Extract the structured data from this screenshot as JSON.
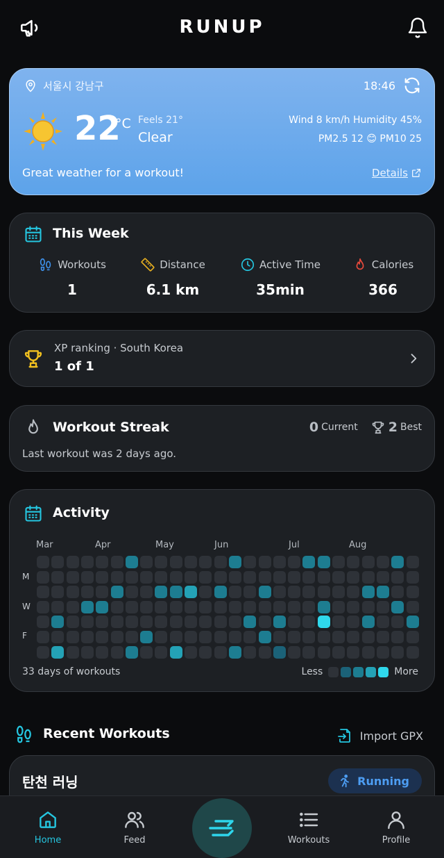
{
  "header": {
    "logo": "RUNUP",
    "left_icon": "megaphone-icon",
    "right_icon": "bell-icon"
  },
  "weather": {
    "location": "서울시 강남구",
    "time": "18:46",
    "temperature": "22",
    "unit": "°C",
    "feels_like": "Feels 21°",
    "condition": "Clear",
    "wind_humidity": "Wind 8 km/h  Humidity 45%",
    "pm_prefix": "PM2.5 12",
    "pm_emoji": "😊",
    "pm_suffix": "PM10 25",
    "message": "Great weather for a workout!",
    "details_label": "Details"
  },
  "this_week": {
    "title": "This Week",
    "stats": [
      {
        "label": "Workouts",
        "value": "1",
        "icon": "footprints-icon",
        "color": "#3d8fe8"
      },
      {
        "label": "Distance",
        "value": "6.1 km",
        "icon": "ruler-icon",
        "color": "#e8b020"
      },
      {
        "label": "Active Time",
        "value": "35min",
        "icon": "clock-icon",
        "color": "#25c6e0"
      },
      {
        "label": "Calories",
        "value": "366",
        "icon": "flame-icon",
        "color": "#ea4a3c"
      }
    ]
  },
  "ranking": {
    "subtitle": "XP ranking · South Korea",
    "value": "1 of 1"
  },
  "streak": {
    "title": "Workout Streak",
    "current_value": "0",
    "current_label": "Current",
    "best_value": "2",
    "best_label": "Best",
    "subtitle": "Last workout was 2 days ago."
  },
  "activity": {
    "title": "Activity",
    "months": [
      "Mar",
      "Apr",
      "May",
      "Jun",
      "Jul",
      "Aug"
    ],
    "day_labels": [
      "M",
      "W",
      "F"
    ],
    "footer": "33 days of workouts",
    "legend_less": "Less",
    "legend_more": "More",
    "levels_colors": [
      "#2e3238",
      "#1b6278",
      "#1d7d91",
      "#24a2b6",
      "#2fd8ec"
    ],
    "legend_colors": [
      "#2e3238",
      "#1b6278",
      "#1d7d91",
      "#24a2b6",
      "#2fd8ec"
    ],
    "weeks": 26,
    "active_cells": [
      [
        6,
        0,
        2
      ],
      [
        13,
        0,
        2
      ],
      [
        18,
        0,
        2
      ],
      [
        19,
        0,
        2
      ],
      [
        24,
        0,
        2
      ],
      [
        5,
        2,
        2
      ],
      [
        8,
        2,
        2
      ],
      [
        9,
        2,
        2
      ],
      [
        10,
        2,
        3
      ],
      [
        12,
        2,
        2
      ],
      [
        15,
        2,
        2
      ],
      [
        22,
        2,
        2
      ],
      [
        23,
        2,
        2
      ],
      [
        3,
        3,
        2
      ],
      [
        4,
        3,
        2
      ],
      [
        19,
        3,
        2
      ],
      [
        24,
        3,
        2
      ],
      [
        1,
        4,
        2
      ],
      [
        14,
        4,
        2
      ],
      [
        16,
        4,
        2
      ],
      [
        19,
        4,
        4
      ],
      [
        22,
        4,
        2
      ],
      [
        25,
        4,
        2
      ],
      [
        7,
        5,
        2
      ],
      [
        15,
        5,
        2
      ],
      [
        1,
        6,
        3
      ],
      [
        6,
        6,
        2
      ],
      [
        9,
        6,
        3
      ],
      [
        13,
        6,
        2
      ],
      [
        16,
        6,
        1
      ]
    ]
  },
  "recent": {
    "title": "Recent Workouts",
    "import_label": "Import GPX",
    "workout_name": "탄천 러닝",
    "workout_type": "Running"
  },
  "nav": {
    "home": "Home",
    "feed": "Feed",
    "workouts": "Workouts",
    "profile": "Profile"
  }
}
